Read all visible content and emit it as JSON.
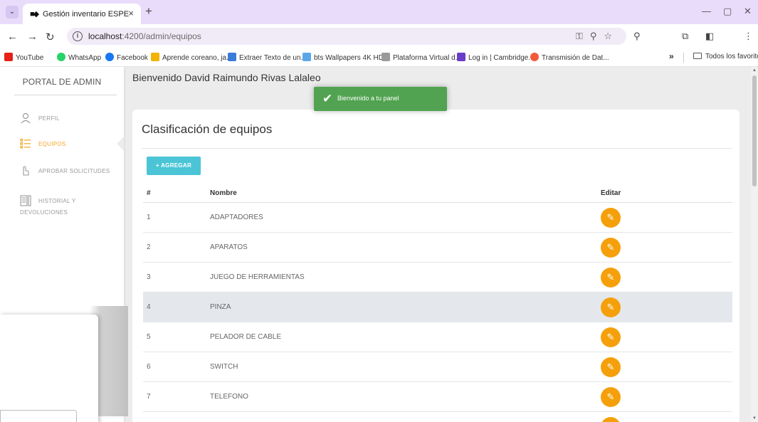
{
  "browser": {
    "tab_title": "Gestión inventario ESPE",
    "url_host": "localhost",
    "url_path": ":4200/admin/equipos",
    "bookmarks": [
      {
        "label": "YouTube",
        "color": "#e62117"
      },
      {
        "label": "WhatsApp",
        "color": "#25d366"
      },
      {
        "label": "Facebook",
        "color": "#1877f2"
      },
      {
        "label": "Aprende coreano, ja...",
        "color": "#f2b300"
      },
      {
        "label": "Extraer Texto de un...",
        "color": "#3b7bd8"
      },
      {
        "label": "bts Wallpapers 4K HD",
        "color": "#5aa7e8"
      },
      {
        "label": "Plataforma Virtual d...",
        "color": "#9a9a9a"
      },
      {
        "label": "Log in | Cambridge...",
        "color": "#6a3cc8"
      },
      {
        "label": "Transmisión de Dat...",
        "color": "#f05a3a"
      }
    ],
    "bookmarks_more": "»",
    "bookmarks_folder": "Todos los favoritos"
  },
  "sidebar": {
    "title": "PORTAL DE ADMIN",
    "items": [
      {
        "label": "PERFIL",
        "icon": "user-icon"
      },
      {
        "label": "EQUIPOS",
        "icon": "list-icon"
      },
      {
        "label": "APROBAR SOLICITUDES",
        "icon": "hand-icon"
      },
      {
        "label": "HISTORIAL Y",
        "icon": "columns-icon"
      }
    ],
    "item4_line2": "DEVOLUCIONES"
  },
  "header": {
    "welcome": "Bienvenido David Raimundo Rivas Lalaleo"
  },
  "toast": {
    "message": "Bienvenido a tu panel"
  },
  "card": {
    "title": "Clasificación de equipos",
    "add_button": "+ AGREGAR"
  },
  "table": {
    "headers": [
      "#",
      "Nombre",
      "Editar"
    ],
    "rows": [
      {
        "num": "1",
        "name": "ADAPTADORES"
      },
      {
        "num": "2",
        "name": "APARATOS"
      },
      {
        "num": "3",
        "name": "JUEGO DE HERRAMIENTAS"
      },
      {
        "num": "4",
        "name": "PINZA"
      },
      {
        "num": "5",
        "name": "PELADOR DE CABLE"
      },
      {
        "num": "6",
        "name": "SWITCH"
      },
      {
        "num": "7",
        "name": "TELEFONO"
      }
    ]
  },
  "colors": {
    "accent": "#f5a623",
    "edit_button": "#f5a00a",
    "add_button": "#4bc5d6",
    "toast": "#51a351",
    "tabbar": "#e9dcfb"
  }
}
